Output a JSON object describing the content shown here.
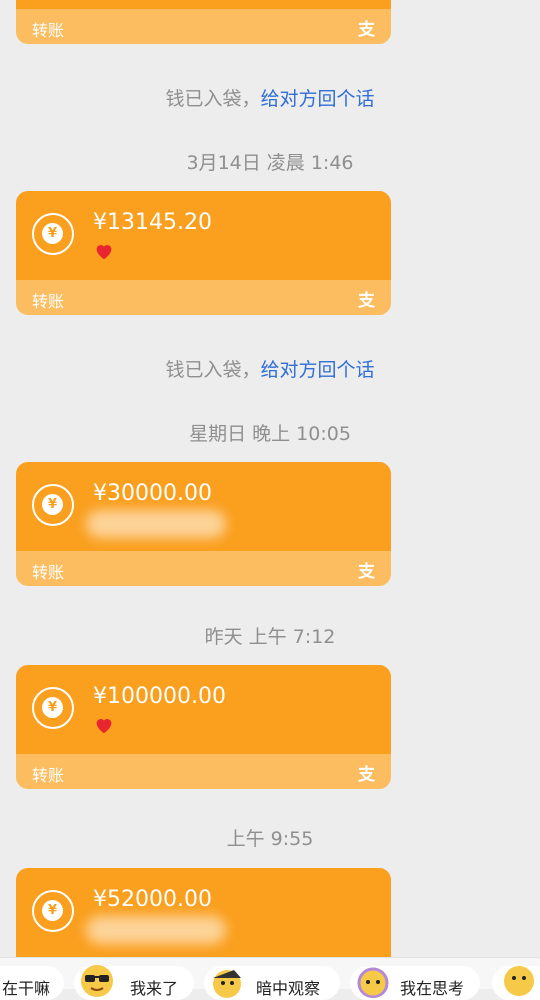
{
  "transfer_label": "转账",
  "pay_icon_glyph": "支",
  "cards": [
    {
      "amount": "",
      "has_heart": false,
      "blurred": false
    },
    {
      "amount": "¥13145.20",
      "has_heart": true,
      "blurred": false
    },
    {
      "amount": "¥30000.00",
      "has_heart": false,
      "blurred": true
    },
    {
      "amount": "¥100000.00",
      "has_heart": true,
      "blurred": false
    },
    {
      "amount": "¥52000.00",
      "has_heart": false,
      "blurred": true
    }
  ],
  "notices": [
    {
      "text": "钱已入袋，",
      "link": "给对方回个话"
    },
    {
      "text": "钱已入袋，",
      "link": "给对方回个话"
    }
  ],
  "timestamps": [
    "3月14日 凌晨 1:46",
    "星期日 晚上 10:05",
    "昨天 上午 7:12",
    "上午 9:55"
  ],
  "suggestions": [
    {
      "label": "在干嘛",
      "icon": "partial-emoji-icon"
    },
    {
      "label": "我来了",
      "icon": "sunglasses-emoji-icon"
    },
    {
      "label": "暗中观察",
      "icon": "peeking-emoji-icon"
    },
    {
      "label": "我在思考",
      "icon": "thinking-emoji-icon"
    },
    {
      "label": "",
      "icon": "smile-emoji-icon"
    }
  ],
  "colors": {
    "card_top": "#fa9f1e",
    "card_bottom": "#fbbd5f",
    "link": "#2f6fd6",
    "background": "#ededed"
  }
}
